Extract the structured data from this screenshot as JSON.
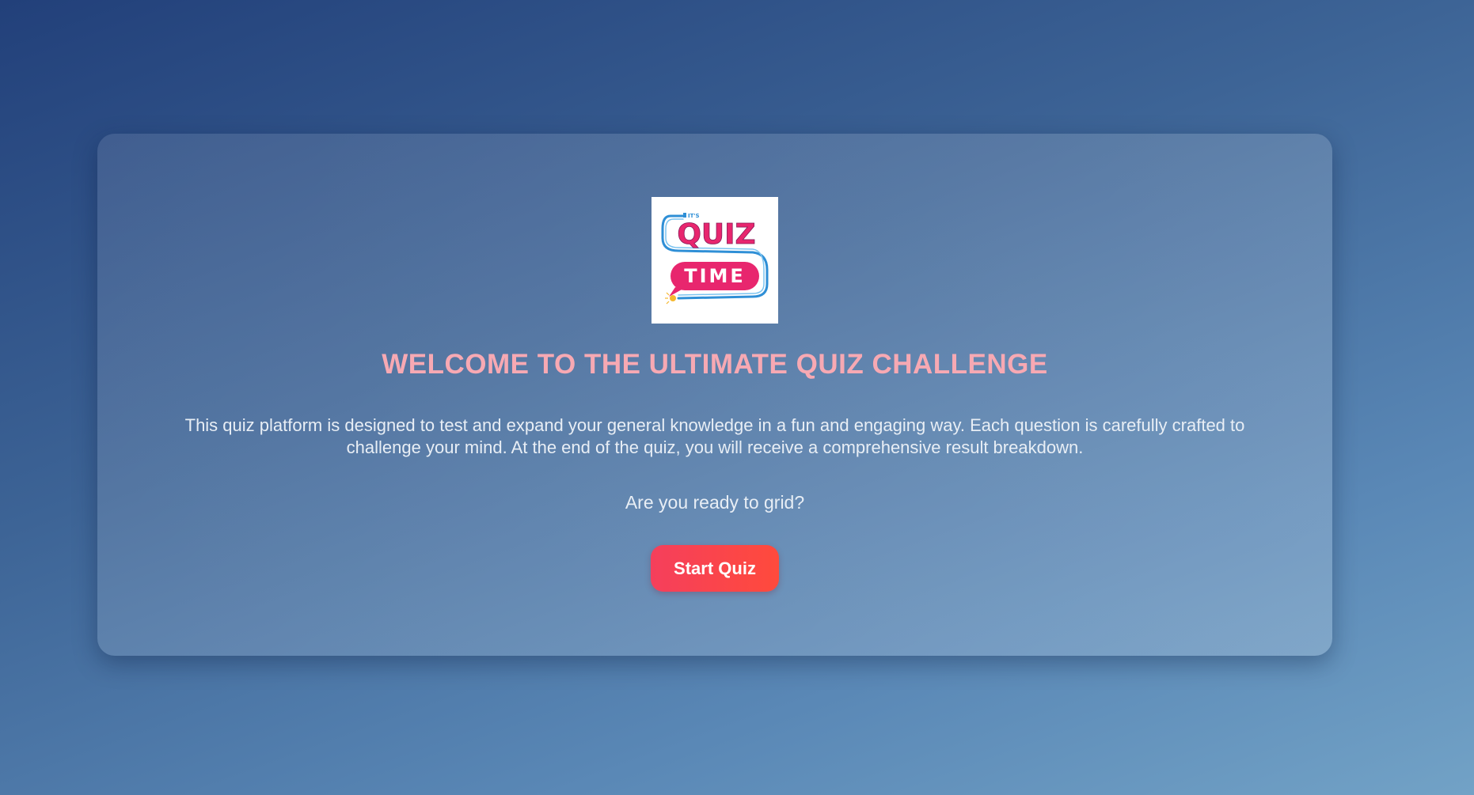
{
  "logo": {
    "small_text": "IT'S",
    "line1": "QUIZ",
    "line2": "TIME"
  },
  "welcome": {
    "title": "WELCOME TO THE ULTIMATE QUIZ CHALLENGE",
    "description": "This quiz platform is designed to test and expand your general knowledge in a fun and engaging way. Each question is carefully crafted to challenge your mind. At the end of the quiz, you will receive a comprehensive result breakdown.",
    "prompt": "Are you ready to grid?",
    "start_label": "Start Quiz"
  },
  "colors": {
    "title": "#f7a9b3",
    "button": "#f53f5c",
    "logo_pink": "#e8266e",
    "logo_blue": "#2f8fd6"
  }
}
